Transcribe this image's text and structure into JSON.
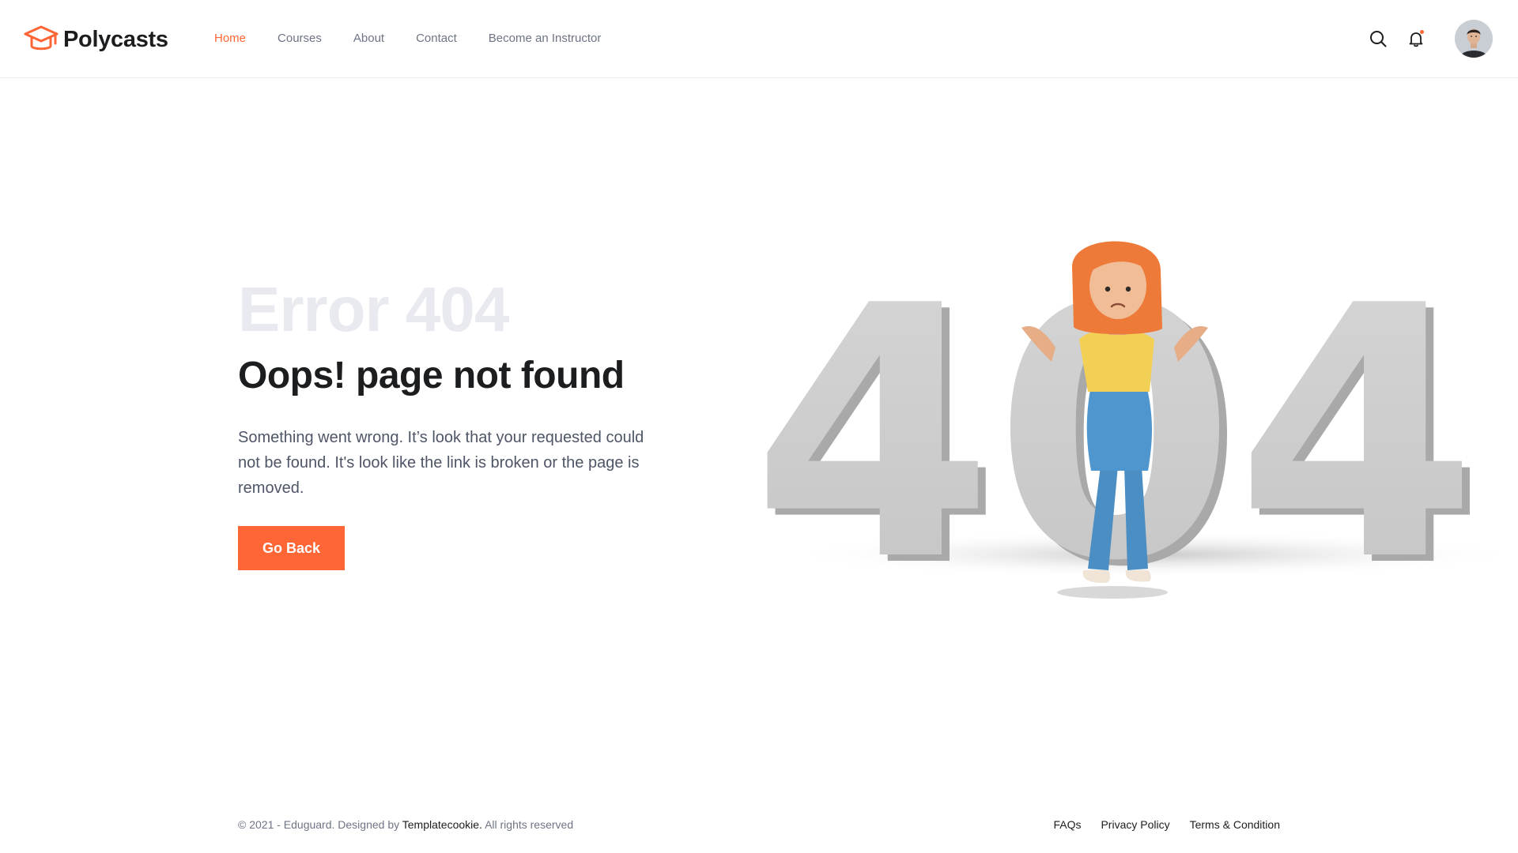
{
  "header": {
    "brand": "Polycasts",
    "nav": [
      {
        "label": "Home",
        "active": true
      },
      {
        "label": "Courses"
      },
      {
        "label": "About"
      },
      {
        "label": "Contact"
      },
      {
        "label": "Become an Instructor"
      }
    ],
    "icons": {
      "search": "search-icon",
      "notifications": "bell-icon",
      "profile": "avatar"
    }
  },
  "error": {
    "code": "Error 404",
    "headline": "Oops! page not found",
    "description": "Something went wrong. It’s look that your requested could not be found. It's look like the link is broken or the page is removed.",
    "button_label": "Go Back",
    "illustration_text": "404"
  },
  "footer": {
    "copyright_prefix": "© 2021 - Eduguard. Designed by",
    "designer": "Templatecookie.",
    "copyright_suffix": "All rights reserved",
    "links": [
      {
        "label": "FAQs"
      },
      {
        "label": "Privacy Policy"
      },
      {
        "label": "Terms & Condition"
      }
    ]
  },
  "colors": {
    "accent": "#ff6636",
    "text_dark": "#1c1d1f",
    "text_muted": "#6e7485",
    "error_code": "#e9eaf0"
  }
}
